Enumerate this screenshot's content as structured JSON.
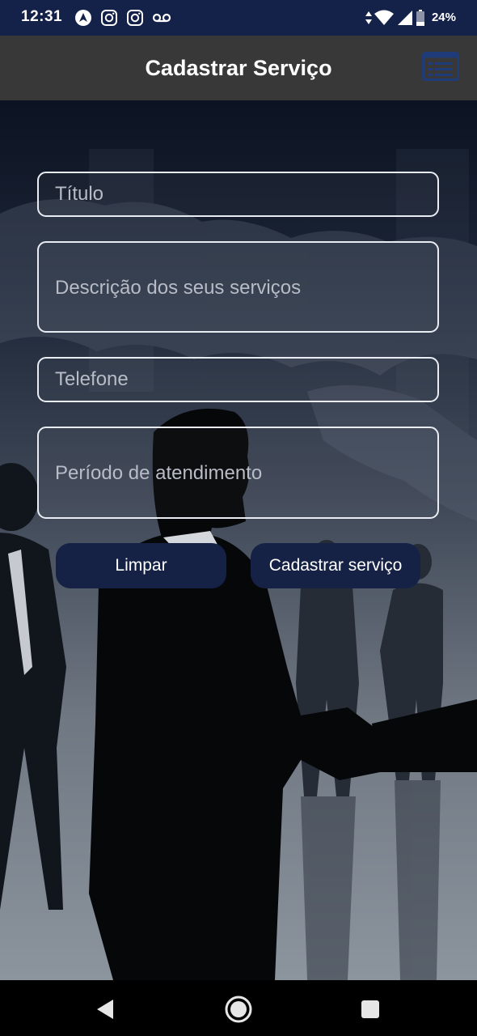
{
  "status_bar": {
    "time": "12:31",
    "battery": "24%",
    "icons": [
      "navigation-app-icon",
      "instagram-icon",
      "instagram-icon",
      "voicemail-icon",
      "data-arrows-icon",
      "wifi-icon",
      "signal-icon",
      "battery-icon"
    ]
  },
  "app_bar": {
    "title": "Cadastrar Serviço",
    "menu_icon": "list-menu-icon",
    "menu_icon_color": "#1f3b7a"
  },
  "form": {
    "titulo_placeholder": "Título",
    "descricao_placeholder": "Descrição dos seus serviços",
    "telefone_placeholder": "Telefone",
    "periodo_placeholder": "Período de atendimento",
    "clear_label": "Limpar",
    "submit_label": "Cadastrar serviço"
  },
  "colors": {
    "status_bar": "#14224a",
    "app_bar": "#383838",
    "button": "#162245",
    "field_border": "#e9ecf2"
  },
  "nav_bar": {
    "icons": [
      "back-icon",
      "home-icon",
      "recents-icon"
    ]
  }
}
